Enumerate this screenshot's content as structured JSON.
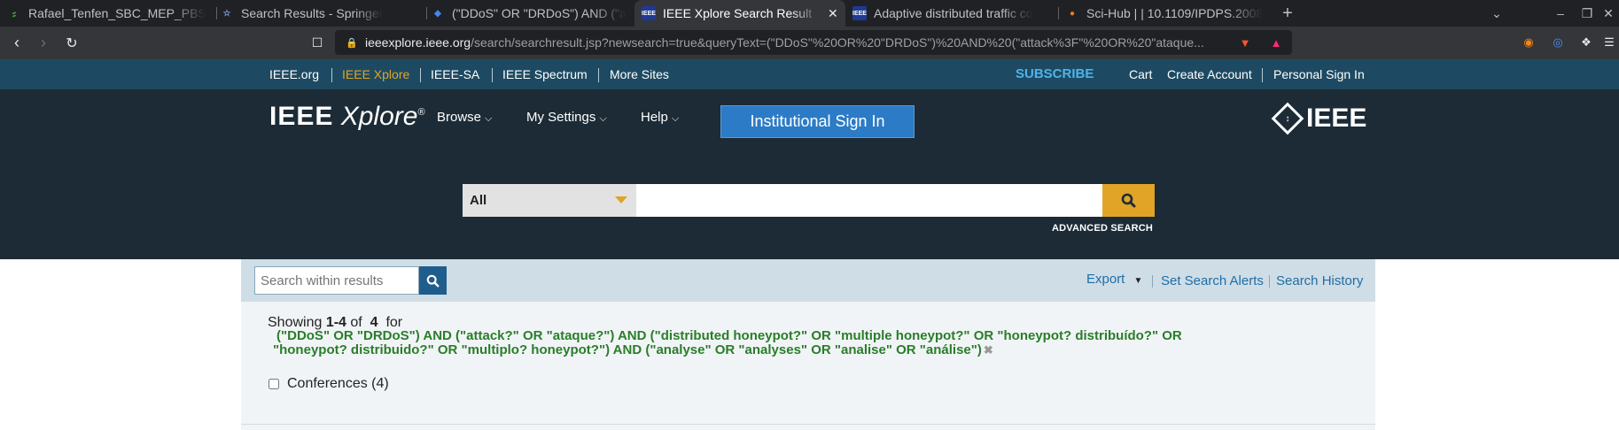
{
  "browser": {
    "tabs": [
      {
        "title": "Rafael_Tenfen_SBC_MEP_PBS",
        "icon": "overleaf-icon",
        "active": false
      },
      {
        "title": "Search Results - Springer",
        "icon": "springer-icon",
        "active": false
      },
      {
        "title": "(\"DDoS\" OR \"DRDoS\") AND (\"a",
        "icon": "scholar-icon",
        "active": false
      },
      {
        "title": "IEEE Xplore Search Result",
        "icon": "ieee-icon",
        "active": true
      },
      {
        "title": "Adaptive distributed traffic co",
        "icon": "ieee-icon",
        "active": false
      },
      {
        "title": "Sci-Hub | | 10.1109/IPDPS.2008",
        "icon": "scihub-icon",
        "active": false
      }
    ],
    "url_domain": "ieeexplore.ieee.org",
    "url_path": "/search/searchresult.jsp?newsearch=true&queryText=(\"DDoS\"%20OR%20\"DRDoS\")%20AND%20(\"attack%3F\"%20OR%20\"ataque..."
  },
  "ieee_top": {
    "links": [
      "IEEE.org",
      "IEEE Xplore",
      "IEEE-SA",
      "IEEE Spectrum",
      "More Sites"
    ],
    "subscribe": "SUBSCRIBE",
    "cart": "Cart",
    "create_account": "Create Account",
    "sign_in": "Personal Sign In"
  },
  "header": {
    "logo_bold": "IEEE",
    "logo_italic": "Xplore",
    "logo_reg": "®",
    "menu": [
      "Browse",
      "My Settings",
      "Help"
    ],
    "institutional_btn": "Institutional Sign In",
    "brand": "IEEE",
    "search_category": "All",
    "advanced_search": "ADVANCED SEARCH"
  },
  "results_bar": {
    "within_placeholder": "Search within results",
    "export": "Export",
    "set_alerts": "Set Search Alerts",
    "history": "Search History"
  },
  "results": {
    "showing_prefix": "Showing",
    "range": "1-4",
    "of": "of",
    "total": "4",
    "for": "for",
    "query_line1": "(\"DDoS\" OR \"DRDoS\") AND (\"attack?\" OR \"ataque?\") AND (\"distributed honeypot?\" OR \"multiple honeypot?\" OR \"honeypot? distribuído?\" OR",
    "query_line2": "\"honeypot? distribuido?\" OR \"multiplo? honeypot?\") AND (\"analyse\" OR \"analyses\" OR \"analise\" OR \"análise\")",
    "facet_label": "Conferences (4)"
  },
  "colors": {
    "ieee_dark": "#1c2b36",
    "ieee_topbar": "#1d4a62",
    "accent_gold": "#e1a427",
    "button_blue": "#2b7bc6",
    "query_green": "#2a7d2a"
  }
}
